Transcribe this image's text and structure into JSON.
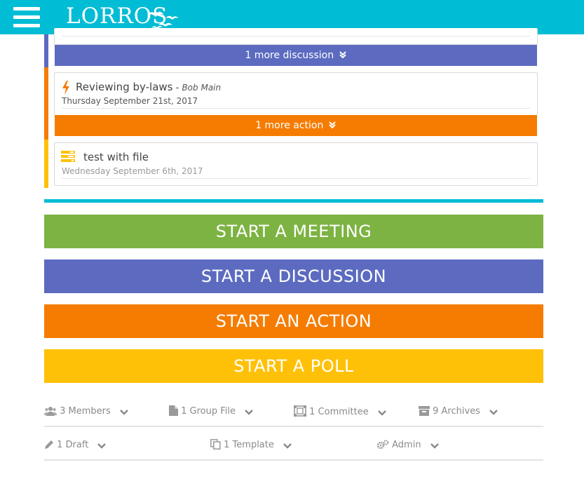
{
  "header": {
    "logo_text": "LORROS"
  },
  "cards": {
    "more_discussion": "1 more discussion",
    "action": {
      "title": "Reviewing by-laws",
      "author_prefix": " - ",
      "author": "Bob Main",
      "date": "Thursday September 21st, 2017"
    },
    "more_action": "1 more action",
    "poll": {
      "title": "test with file",
      "date": "Wednesday September 6th, 2017"
    }
  },
  "buttons": {
    "meeting": "START A MEETING",
    "discussion": "START A DISCUSSION",
    "action": "START AN ACTION",
    "poll": "START A POLL"
  },
  "stats": {
    "members": "3 Members",
    "group_file": "1 Group File",
    "committee": "1 Committee",
    "archives": "9 Archives",
    "draft": "1 Draft",
    "template": "1 Template",
    "admin": "Admin"
  },
  "colors": {
    "teal": "#00bcd4",
    "purple": "#5c6bc0",
    "orange": "#f57c00",
    "yellow": "#ffc107",
    "green": "#7cb342"
  }
}
